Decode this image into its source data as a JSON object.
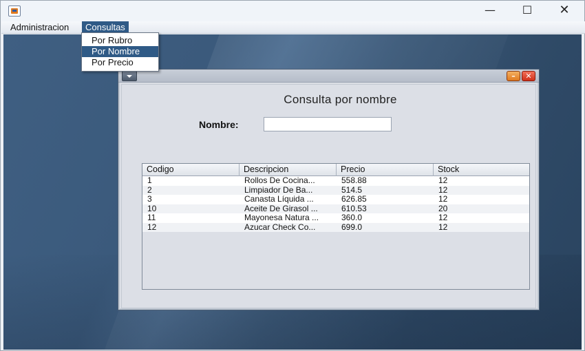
{
  "window": {
    "icon": "java-icon",
    "controls": {
      "minimize": "—",
      "maximize": "☐",
      "close": "✕"
    }
  },
  "menubar": {
    "items": [
      "Administracion",
      "Consultas"
    ],
    "active": "Consultas"
  },
  "dropdown": {
    "items": [
      "Por Rubro",
      "Por Nombre",
      "Por Precio"
    ],
    "selected": "Por Nombre"
  },
  "internal_frame": {
    "title": "Consulta por nombre",
    "nombre_label": "Nombre:",
    "nombre_value": "",
    "controls": {
      "minimize": "–",
      "close": "✕"
    }
  },
  "table": {
    "columns": [
      "Codigo",
      "Descripcion",
      "Precio",
      "Stock"
    ],
    "rows": [
      [
        "1",
        "Rollos De Cocina...",
        "558.88",
        "12"
      ],
      [
        "2",
        "Limpiador De Ba...",
        "514.5",
        "12"
      ],
      [
        "3",
        "Canasta Líquida ...",
        "626.85",
        "12"
      ],
      [
        "10",
        "Aceite De Girasol ...",
        "610.53",
        "20"
      ],
      [
        "11",
        "Mayonesa Natura ...",
        "360.0",
        "12"
      ],
      [
        "12",
        "Azucar Check Co...",
        "699.0",
        "12"
      ]
    ]
  },
  "colors": {
    "menu_highlight": "#2f5a86",
    "desktop": "#3b5a7c"
  }
}
